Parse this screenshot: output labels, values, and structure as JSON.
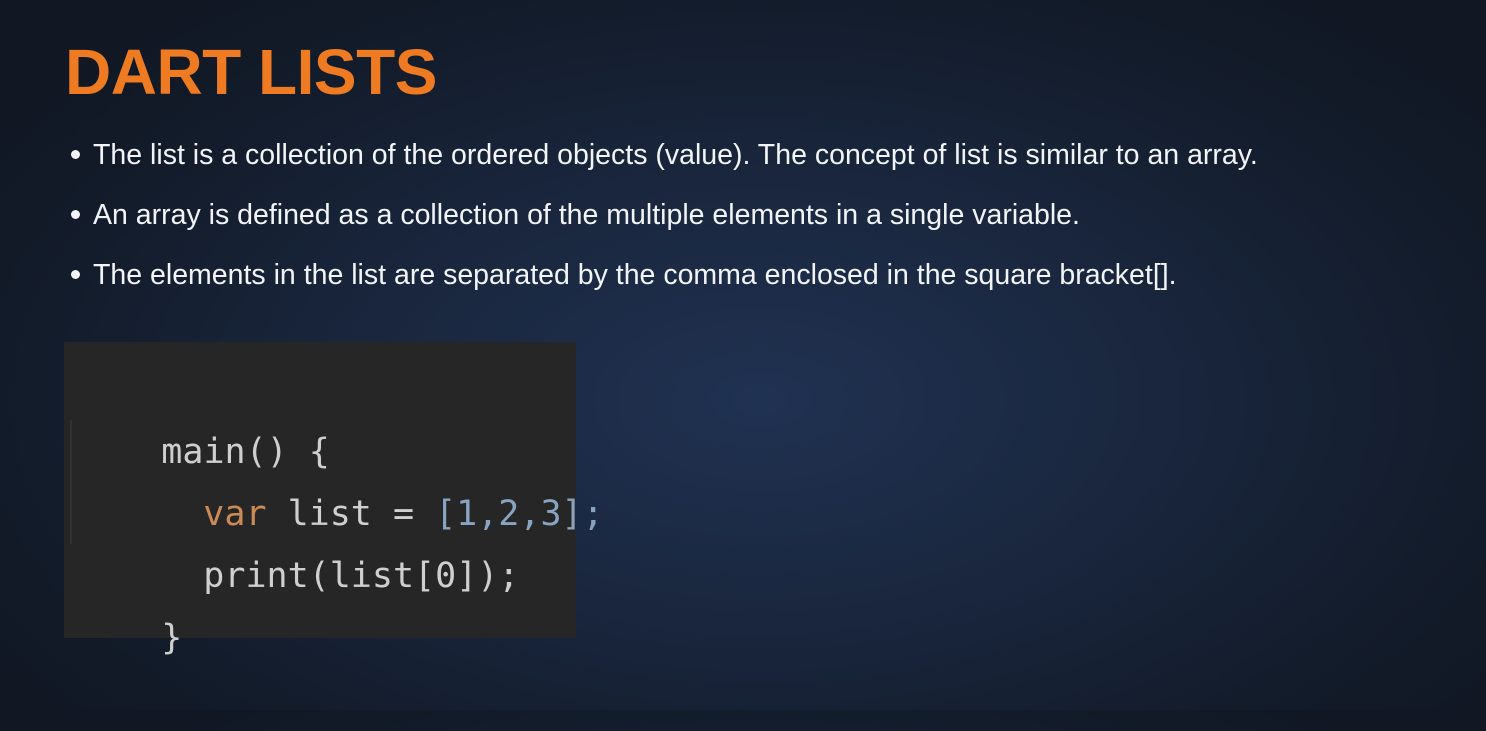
{
  "title": "DART LISTS",
  "bullets": [
    "The list is a collection of the ordered objects (value). The concept of list is similar to an array.",
    "An array is defined as a collection of the multiple elements in a single variable.",
    "The elements in the list are separated by the comma enclosed in the square bracket[]."
  ],
  "code": {
    "line1": "main() {",
    "line2_keyword": "var",
    "line2_ident": " list = ",
    "line2_value": "[1,2,3];",
    "line3": "print(list[0]);",
    "line4": "}"
  },
  "colors": {
    "title": "#ee7a22",
    "text": "#f2f4f7",
    "code_default": "#cfcfcf",
    "code_keyword": "#cc8a55",
    "code_number": "#88a4c2",
    "code_background": "#262626"
  }
}
